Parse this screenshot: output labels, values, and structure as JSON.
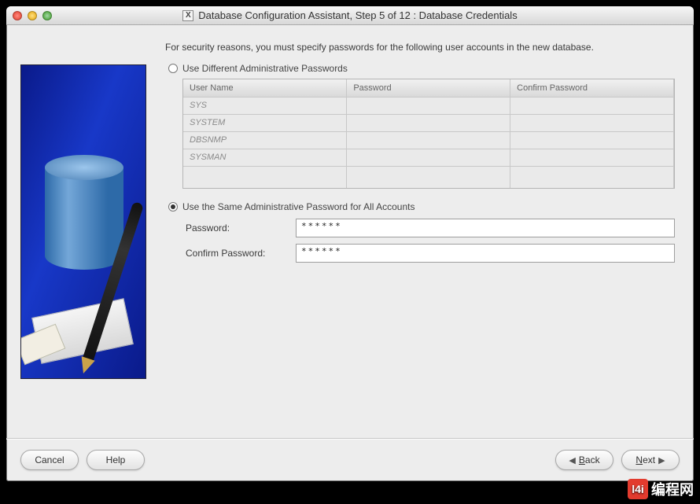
{
  "window": {
    "title": "Database Configuration Assistant, Step 5 of 12 : Database Credentials"
  },
  "intro": "For security reasons, you must specify passwords for the following user accounts in the new database.",
  "option_different": {
    "label": "Use Different Administrative Passwords",
    "selected": false
  },
  "table": {
    "headers": {
      "user": "User Name",
      "password": "Password",
      "confirm": "Confirm Password"
    },
    "rows": [
      {
        "user": "SYS",
        "password": "",
        "confirm": ""
      },
      {
        "user": "SYSTEM",
        "password": "",
        "confirm": ""
      },
      {
        "user": "DBSNMP",
        "password": "",
        "confirm": ""
      },
      {
        "user": "SYSMAN",
        "password": "",
        "confirm": ""
      }
    ]
  },
  "option_same": {
    "label": "Use the Same Administrative Password for All Accounts",
    "selected": true
  },
  "fields": {
    "password_label": "Password:",
    "password_value": "******",
    "confirm_label": "Confirm Password:",
    "confirm_value": "******"
  },
  "buttons": {
    "cancel": "Cancel",
    "help": "Help",
    "back_prefix": "B",
    "back_rest": "ack",
    "next_prefix": "N",
    "next_rest": "ext"
  },
  "watermark": {
    "badge": "l4i",
    "text": "编程网"
  }
}
